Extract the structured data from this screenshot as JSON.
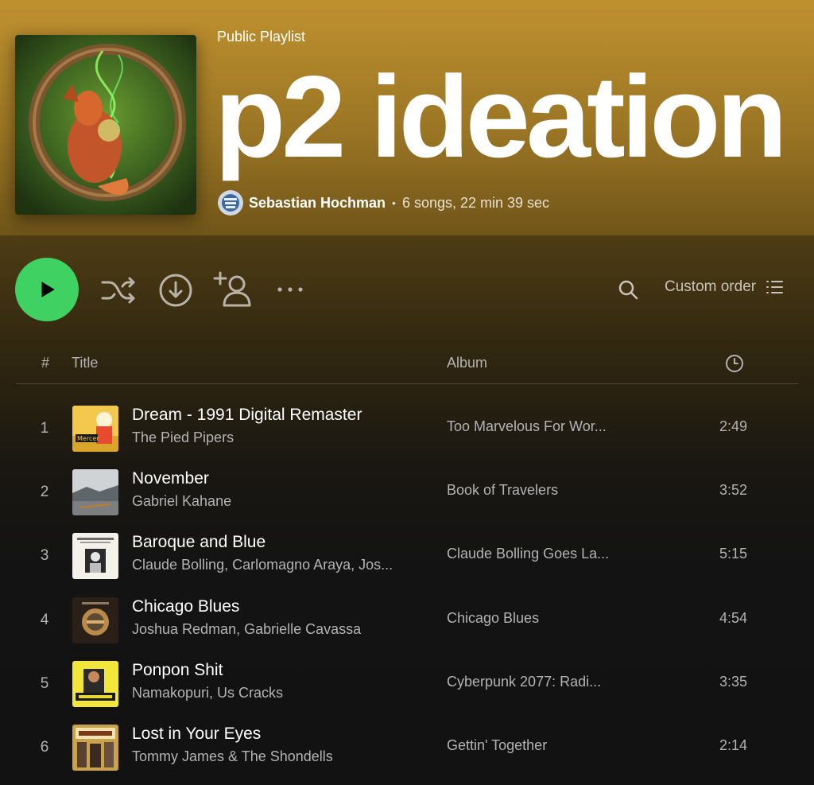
{
  "header": {
    "kind": "Public Playlist",
    "title": "p2 ideation",
    "owner": "Sebastian Hochman",
    "separator": "•",
    "stats": "6 songs, 22 min 39 sec"
  },
  "controls": {
    "sort_label": "Custom order",
    "icons": [
      "play-icon",
      "shuffle-icon",
      "download-icon",
      "add-user-icon",
      "more-icon",
      "search-icon",
      "list-icon"
    ]
  },
  "table": {
    "headers": {
      "num": "#",
      "title": "Title",
      "album": "Album",
      "duration_icon": "clock-icon"
    },
    "tracks": [
      {
        "num": "1",
        "title": "Dream - 1991 Digital Remaster",
        "artist": "The Pied Pipers",
        "album": "Too Marvelous For Wor...",
        "duration": "2:49"
      },
      {
        "num": "2",
        "title": "November",
        "artist": "Gabriel Kahane",
        "album": "Book of Travelers",
        "duration": "3:52"
      },
      {
        "num": "3",
        "title": "Baroque and Blue",
        "artist": "Claude Bolling, Carlomagno Araya, Jos...",
        "album": "Claude Bolling Goes La...",
        "duration": "5:15"
      },
      {
        "num": "4",
        "title": "Chicago Blues",
        "artist": "Joshua Redman, Gabrielle Cavassa",
        "album": "Chicago Blues",
        "duration": "4:54"
      },
      {
        "num": "5",
        "title": "Ponpon Shit",
        "artist": "Namakopuri, Us Cracks",
        "album": "Cyberpunk 2077: Radi...",
        "duration": "3:35"
      },
      {
        "num": "6",
        "title": "Lost in Your Eyes",
        "artist": "Tommy James & The Shondells",
        "album": "Gettin' Together",
        "duration": "2:14"
      }
    ]
  },
  "colors": {
    "accent": "#3fd263",
    "header_gold": "#c0912f",
    "background": "#121212"
  }
}
